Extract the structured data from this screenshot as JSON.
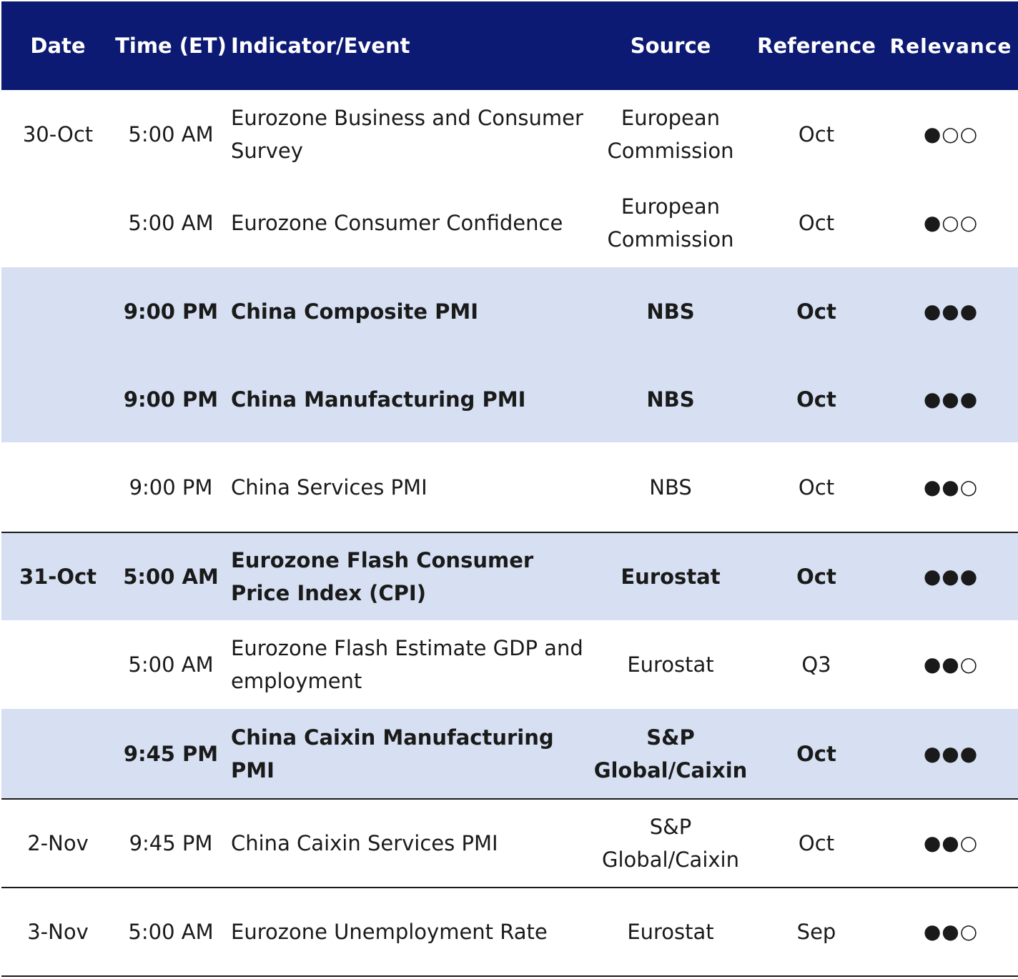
{
  "header": {
    "date": "Date",
    "time": "Time (ET)",
    "event": "Indicator/Event",
    "source": "Source",
    "reference": "Reference",
    "relevance": "Relevance"
  },
  "rows": [
    {
      "date": "30-Oct",
      "time": "5:00 AM",
      "event": "Eurozone Business and Consumer Survey",
      "source": "European Commission",
      "reference": "Oct",
      "relevance": "●○○"
    },
    {
      "date": "",
      "time": "5:00 AM",
      "event": "Eurozone Consumer Confidence",
      "source": "European Commission",
      "reference": "Oct",
      "relevance": "●○○"
    },
    {
      "date": "",
      "time": "9:00 PM",
      "event": "China Composite PMI",
      "source": "NBS",
      "reference": "Oct",
      "relevance": "●●●"
    },
    {
      "date": "",
      "time": "9:00 PM",
      "event": "China Manufacturing PMI",
      "source": "NBS",
      "reference": "Oct",
      "relevance": "●●●"
    },
    {
      "date": "",
      "time": "9:00 PM",
      "event": "China Services PMI",
      "source": "NBS",
      "reference": "Oct",
      "relevance": "●●○"
    },
    {
      "date": "31-Oct",
      "time": "5:00 AM",
      "event": "Eurozone Flash Consumer Price Index (CPI)",
      "source": "Eurostat",
      "reference": "Oct",
      "relevance": "●●●"
    },
    {
      "date": "",
      "time": "5:00 AM",
      "event": "Eurozone Flash Estimate GDP and employment",
      "source": "Eurostat",
      "reference": "Q3",
      "relevance": "●●○"
    },
    {
      "date": "",
      "time": "9:45 PM",
      "event": "China Caixin Manufacturing PMI",
      "source": "S&P Global/Caixin",
      "reference": "Oct",
      "relevance": "●●●"
    },
    {
      "date": "2-Nov",
      "time": "9:45 PM",
      "event": "China Caixin Services PMI",
      "source": "S&P Global/Caixin",
      "reference": "Oct",
      "relevance": "●●○"
    },
    {
      "date": "3-Nov",
      "time": "5:00 AM",
      "event": "Eurozone Unemployment Rate",
      "source": "Eurostat",
      "reference": "Sep",
      "relevance": "●●○"
    }
  ]
}
